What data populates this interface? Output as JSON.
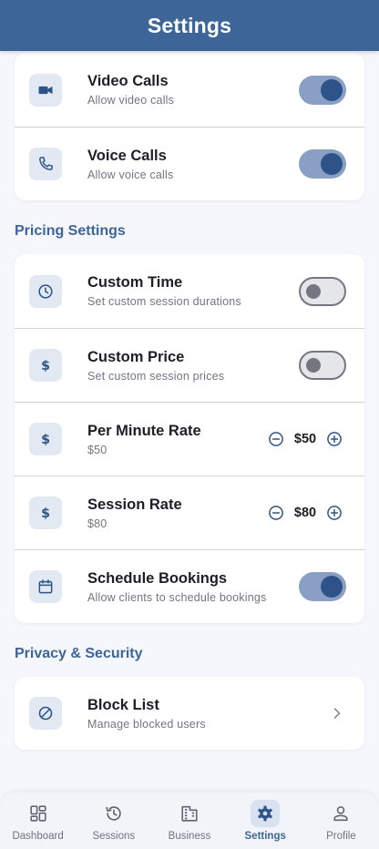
{
  "header": {
    "title": "Settings"
  },
  "communication": [
    {
      "title": "Video Calls",
      "subtitle": "Allow video calls",
      "icon": "video-camera-icon",
      "toggle": true
    },
    {
      "title": "Voice Calls",
      "subtitle": "Allow voice calls",
      "icon": "phone-icon",
      "toggle": true
    }
  ],
  "pricing": {
    "section_title": "Pricing Settings",
    "custom_time": {
      "title": "Custom Time",
      "subtitle": "Set custom session durations",
      "icon": "clock-icon",
      "toggle": false
    },
    "custom_price": {
      "title": "Custom Price",
      "subtitle": "Set custom session prices",
      "icon": "dollar-icon",
      "toggle": false
    },
    "per_minute": {
      "title": "Per Minute Rate",
      "subtitle": "$50",
      "value": "$50",
      "icon": "dollar-icon"
    },
    "session_rate": {
      "title": "Session Rate",
      "subtitle": "$80",
      "value": "$80",
      "icon": "dollar-icon"
    },
    "schedule": {
      "title": "Schedule Bookings",
      "subtitle": "Allow clients to schedule bookings",
      "icon": "calendar-icon",
      "toggle": true
    }
  },
  "privacy": {
    "section_title": "Privacy & Security",
    "block_list": {
      "title": "Block List",
      "subtitle": "Manage blocked users",
      "icon": "block-icon"
    }
  },
  "nav": [
    {
      "label": "Dashboard",
      "icon": "dashboard-icon",
      "active": false
    },
    {
      "label": "Sessions",
      "icon": "history-icon",
      "active": false
    },
    {
      "label": "Business",
      "icon": "building-icon",
      "active": false
    },
    {
      "label": "Settings",
      "icon": "gear-icon",
      "active": true
    },
    {
      "label": "Profile",
      "icon": "person-icon",
      "active": false
    }
  ],
  "colors": {
    "primary": "#3d6598",
    "toggle_on_track": "#8a9fc4",
    "toggle_on_knob": "#2d5389",
    "icon_bg": "#e3e9f3",
    "background": "#f5f7fc"
  }
}
